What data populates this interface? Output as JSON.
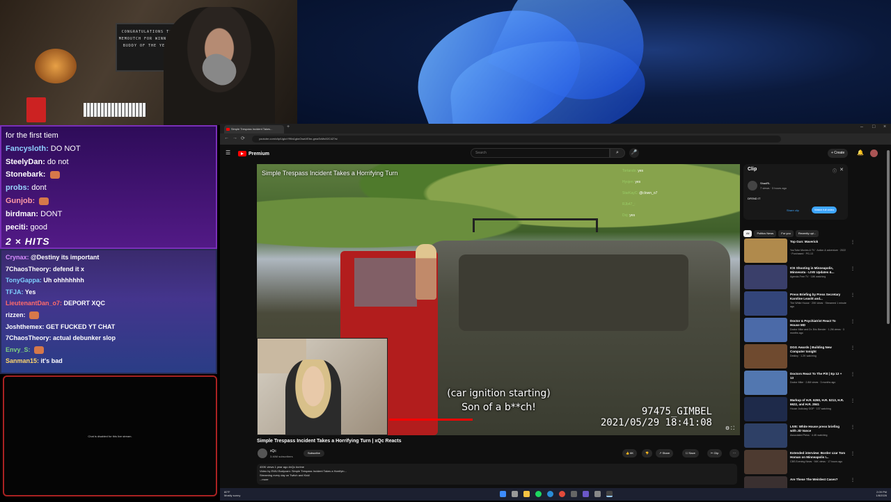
{
  "overlay": {
    "sign_text": "CONGRATULATIONS TO MEMOUTCH FOR WINNING BUDDY OF THE YEAR",
    "hits": "2 × HITS",
    "chat_disabled": "Chat is disabled for this live stream."
  },
  "chat_top": [
    {
      "user": "",
      "msg": "for the first tiem",
      "color": "#ffffff"
    },
    {
      "user": "Fancysloth:",
      "msg": "DO NOT",
      "color": "#8fd0ff"
    },
    {
      "user": "SteelyDan:",
      "msg": "do not",
      "color": "#ffffff"
    },
    {
      "user": "Stonebark:",
      "msg": "",
      "color": "#ffffff"
    },
    {
      "user": "probs:",
      "msg": "dont",
      "color": "#9ad7ff"
    },
    {
      "user": "Gunjob:",
      "msg": "",
      "color": "#ff9aa6"
    },
    {
      "user": "birdman:",
      "msg": "DONT",
      "color": "#ffffff"
    },
    {
      "user": "peciti:",
      "msg": "good",
      "color": "#ffffff"
    }
  ],
  "chat_bottom": [
    {
      "user": "Crynax:",
      "msg": "@Destiny its important",
      "color": "#d88cff"
    },
    {
      "user": "7ChaosTheory:",
      "msg": "defend it x",
      "color": "#ffffff"
    },
    {
      "user": "TonyGappa:",
      "msg": "Uh ohhhhhhh",
      "color": "#7fd0ff"
    },
    {
      "user": "TFJA:",
      "msg": "Yes",
      "color": "#7fd0ff"
    },
    {
      "user": "LieutenantDan_o7:",
      "msg": "DEPORT XQC",
      "color": "#ff6b6b"
    },
    {
      "user": "rizzen:",
      "msg": "",
      "color": "#ffffff"
    },
    {
      "user": "Joshthemex:",
      "msg": "GET FUCKED YT CHAT",
      "color": "#ffffff"
    },
    {
      "user": "7ChaosTheory:",
      "msg": "actual debunker slop",
      "color": "#ffffff"
    },
    {
      "user": "Envy_S:",
      "msg": "",
      "color": "#7fd07f"
    },
    {
      "user": "Sanman15:",
      "msg": "it's bad",
      "color": "#ffd76b"
    }
  ],
  "browser": {
    "tab_title": "Simple Trespass Incident Takes...",
    "url": "youtube.com/clip/UgkxYf9fa1gknOwaVEbn-gmaSxMs92C4Z?si",
    "search_placeholder": "Search",
    "logo_text": "Premium",
    "create_label": "+ Create"
  },
  "video": {
    "overlay_title": "Simple Trespass Incident Takes a Horrifying Turn",
    "caption_line1": "(car ignition starting)",
    "caption_line2": "Son of a b**ch!",
    "stamp_id": "97475_GIMBEL",
    "stamp_time": "2021/05/29 18:41:08",
    "chat": [
      {
        "user": "Tortando:",
        "msg": "yes"
      },
      {
        "user": "Hyojen:",
        "msg": "yes"
      },
      {
        "user": "StarKayC:",
        "msg": "@clown_o7"
      },
      {
        "user": "RJb47_:",
        "msg": ""
      },
      {
        "user": "Doj:",
        "msg": "yes"
      }
    ],
    "title": "Simple Trespass Incident Takes a Horrifying Turn | xQc Reacts",
    "channel": "xQc",
    "subs": "3.46M subscribers",
    "subscribe": "Subscribe",
    "likes": "6K",
    "share": "Share",
    "save": "Save",
    "clip": "Clip",
    "desc_line1": "400K views  1 year ago  #xQc #crime",
    "desc_line2": "Video by EWU Bodycam: Simple Trespass Incident Takes a Horrifyin...",
    "desc_line3": "Streaming every day on Twitch and Kick!",
    "desc_more": "...more"
  },
  "clip_panel": {
    "title": "Clip",
    "author": "ShadRL",
    "meta": "7 views · 3 hours ago",
    "text": "DFEND IT",
    "share_clip": "Share clip",
    "watch_full": "Watch full video"
  },
  "chips": [
    "All",
    "Politics News",
    "For you",
    "Recently upl..."
  ],
  "recs": [
    {
      "title": "Top Gun: Maverick",
      "sub": "YouTube Movies & TV · Action & adventure · 2022 · Purchased · PG-13",
      "color": "#b08a4c"
    },
    {
      "title": "ICE Shooting in Minneapolis, Minnesota - LIVE Updates &...",
      "sub": "Agenda-Free TV · 18K watching",
      "color": "#3a3f6a"
    },
    {
      "title": "Press Briefing by Press Secretary Karoline Leavitt and...",
      "sub": "The White House · 20K views · Streamed 1 minute ago",
      "color": "#33457a"
    },
    {
      "title": "Doctor & Psychiatrist React To House MD",
      "sub": "Doctor Mike and Dr. Eric Bender · 1.2M views · 3 months ago",
      "color": "#4b6aa8"
    },
    {
      "title": "DGG Awards | Building New Computer tonight",
      "sub": "Destiny · 1.2K watching",
      "color": "#6f4a2f"
    },
    {
      "title": "Doctors React To The Pitt | Ep 12 + 13",
      "sub": "Doctor Mike · 2.8M views · 3 months ago",
      "color": "#5277b0"
    },
    {
      "title": "Markup of H.R. 6260, H.R. 5213, H.R. 6622, and H.R. 2841",
      "sub": "House Judiciary GOP · 137 watching",
      "color": "#1e2a4a"
    },
    {
      "title": "LIVE: White House press briefing with JD Vance",
      "sub": "Associated Press · 4.4K watching",
      "color": "#2e4066"
    },
    {
      "title": "Extended interview: Border czar Tom Homan on Minneapolis I...",
      "sub": "CBS Evening News · 94K views · 17 hours ago",
      "color": "#4d3a30"
    },
    {
      "title": "Are These The Weirdest Cases?",
      "sub": "",
      "color": "#3a3030"
    }
  ],
  "taskbar": {
    "weather_temp": "80°F",
    "weather_desc": "Mostly sunny",
    "time": "2:09 PM",
    "date": "1/8/2026"
  }
}
